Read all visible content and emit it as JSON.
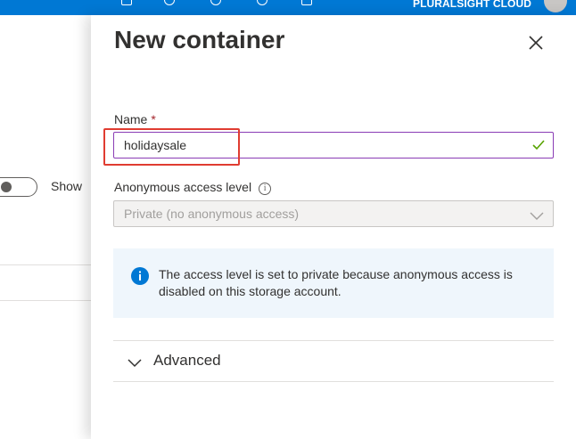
{
  "topbar": {
    "org_label": "PLURALSIGHT CLOUD"
  },
  "background_page": {
    "toggle_label": "Show"
  },
  "panel": {
    "title": "New container",
    "name_field": {
      "label": "Name",
      "required_marker": "*",
      "value": "holidaysale",
      "valid": true
    },
    "access_level": {
      "label": "Anonymous access level",
      "info_icon": "i",
      "selected_value": "Private (no anonymous access)",
      "disabled": true
    },
    "info_message": "The access level is set to private because anonymous access is disabled on this storage account.",
    "advanced_section": {
      "label": "Advanced",
      "expanded": false
    }
  },
  "colors": {
    "accent": "#0078d4",
    "highlight_box": "#e03c31",
    "valid_check": "#57a300",
    "info_blue": "#0078d4",
    "required": "#a4262c"
  }
}
